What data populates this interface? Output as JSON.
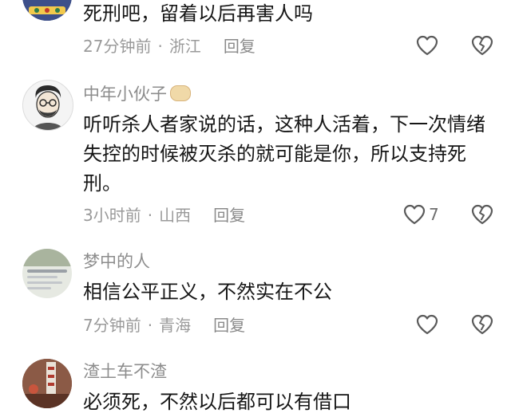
{
  "comments": [
    {
      "username": "",
      "content": "死刑吧，留着以后再害人吗",
      "time": "27分钟前",
      "location": "浙江",
      "reply_label": "回复",
      "like_count": ""
    },
    {
      "username": "中年小伙子",
      "content": "听听杀人者家说的话，这种人活着，下一次情绪失控的时候被灭杀的就可能是你，所以支持死刑。",
      "time": "3小时前",
      "location": "山西",
      "reply_label": "回复",
      "like_count": "7"
    },
    {
      "username": "梦中的人",
      "content": "相信公平正义，不然实在不公",
      "time": "7分钟前",
      "location": "青海",
      "reply_label": "回复",
      "like_count": ""
    },
    {
      "username": "渣土车不渣",
      "content": "必须死，不然以后都可以有借口",
      "time": "",
      "location": "",
      "reply_label": "",
      "like_count": ""
    }
  ],
  "separator": "·",
  "colors": {
    "text": "#161616",
    "username": "#8d8d8d",
    "meta": "#9a9a9a",
    "icon": "#5a5a5a"
  },
  "icons": {
    "like": "heart-icon",
    "dislike": "broken-heart-icon"
  }
}
